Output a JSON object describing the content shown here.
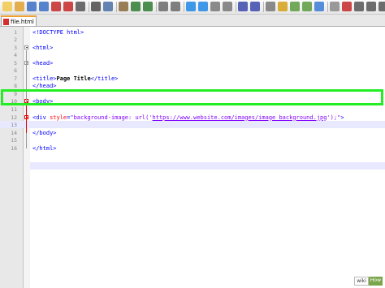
{
  "toolbar": {
    "buttons": [
      "new-file",
      "open-file",
      "save",
      "save-all",
      "close",
      "close-all",
      "print",
      "cut",
      "copy",
      "paste",
      "undo",
      "redo",
      "find",
      "replace",
      "zoom-in",
      "zoom-out",
      "sync-vertical",
      "sync-horizontal",
      "word-wrap",
      "show-all-chars",
      "indent-guide",
      "define-language",
      "doc-map",
      "function-list",
      "folder-workspace",
      "monitor",
      "record-macro",
      "stop-macro",
      "play-macro",
      "run-macro",
      "save-macro"
    ]
  },
  "tab": {
    "label": "file.html"
  },
  "editor": {
    "lines": [
      {
        "n": "1",
        "segs": [
          {
            "t": "<!DOCTYPE html>",
            "c": "tag"
          }
        ]
      },
      {
        "n": "2",
        "segs": []
      },
      {
        "n": "3",
        "segs": [
          {
            "t": "<html>",
            "c": "tag"
          }
        ]
      },
      {
        "n": "4",
        "segs": []
      },
      {
        "n": "5",
        "segs": [
          {
            "t": "<head>",
            "c": "tag"
          }
        ]
      },
      {
        "n": "6",
        "segs": []
      },
      {
        "n": "7",
        "segs": [
          {
            "t": "<title>",
            "c": "tag"
          },
          {
            "t": "Page Title",
            "c": "txt"
          },
          {
            "t": "</title>",
            "c": "tag"
          }
        ]
      },
      {
        "n": "8",
        "segs": [
          {
            "t": "</head>",
            "c": "tag"
          }
        ]
      },
      {
        "n": "9",
        "segs": []
      },
      {
        "n": "10",
        "segs": [
          {
            "t": "<body>",
            "c": "tag"
          }
        ]
      },
      {
        "n": "11",
        "segs": []
      },
      {
        "n": "12",
        "segs": [
          {
            "t": "<div ",
            "c": "tag"
          },
          {
            "t": "style",
            "c": "attr"
          },
          {
            "t": "=",
            "c": "tag"
          },
          {
            "t": "\"background-image: url('",
            "c": "str"
          },
          {
            "t": "https://www.website.com/images/image_background.jpg",
            "c": "str url"
          },
          {
            "t": "');\"",
            "c": "str"
          },
          {
            "t": ">",
            "c": "tag"
          }
        ]
      },
      {
        "n": "13",
        "segs": []
      },
      {
        "n": "14",
        "segs": [
          {
            "t": "</body>",
            "c": "tag"
          }
        ]
      },
      {
        "n": "15",
        "segs": []
      },
      {
        "n": "16",
        "segs": [
          {
            "t": "</html>",
            "c": "tag"
          }
        ]
      }
    ]
  },
  "watermark": {
    "a": "wiki",
    "b": "How"
  },
  "colors": {
    "highlight_box": "#22ee22",
    "tag": "#0000ff",
    "attr": "#ff0000",
    "string": "#8000ff"
  }
}
